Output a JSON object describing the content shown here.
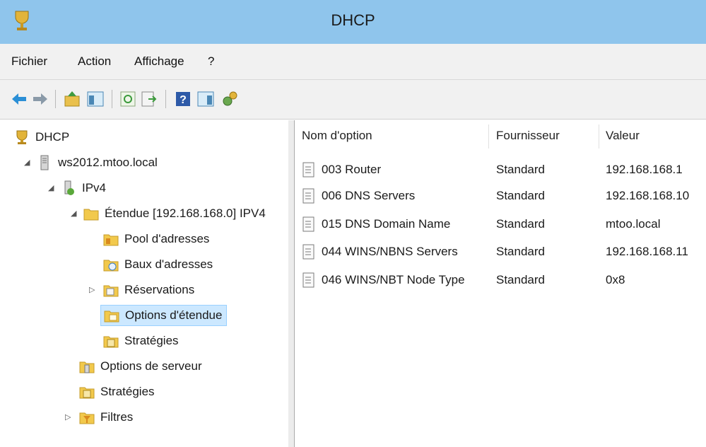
{
  "window": {
    "title": "DHCP"
  },
  "menu": [
    "Fichier",
    "Action",
    "Affichage",
    "?"
  ],
  "tree": {
    "root": "DHCP",
    "server": "ws2012.mtoo.local",
    "ipv4": "IPv4",
    "scope": "Étendue [192.168.168.0] IPV4",
    "address_pool": "Pool d'adresses",
    "address_leases": "Baux d'adresses",
    "reservations": "Réservations",
    "scope_options": "Options d'étendue",
    "scope_policies": "Stratégies",
    "server_options": "Options de serveur",
    "policies": "Stratégies",
    "filters": "Filtres"
  },
  "list": {
    "columns": [
      "Nom d'option",
      "Fournisseur",
      "Valeur"
    ],
    "rows": [
      {
        "name": "003 Router",
        "vendor": "Standard",
        "value": "192.168.168.1"
      },
      {
        "name": "006 DNS Servers",
        "vendor": "Standard",
        "value": "192.168.168.10"
      },
      {
        "name": "015 DNS Domain Name",
        "vendor": "Standard",
        "value": "mtoo.local"
      },
      {
        "name": "044 WINS/NBNS Servers",
        "vendor": "Standard",
        "value": "192.168.168.11"
      },
      {
        "name": "046 WINS/NBT Node Type",
        "vendor": "Standard",
        "value": "0x8"
      }
    ]
  },
  "colors": {
    "titlebar": "#8fc5ec",
    "selection": "#cce8ff",
    "folder": "#f2c94c"
  }
}
